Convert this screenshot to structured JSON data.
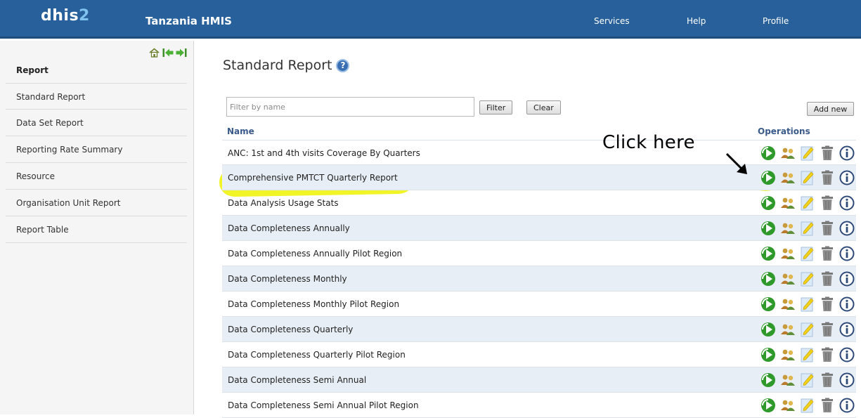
{
  "header": {
    "logo_prefix": "dhis",
    "logo_suffix": "2",
    "app_title": "Tanzania HMIS",
    "menu": [
      "Services",
      "Help",
      "Profile"
    ]
  },
  "sidebar": {
    "nav_icons": [
      "home-icon",
      "back-arrow-icon",
      "forward-arrow-icon"
    ],
    "heading": "Report",
    "items": [
      "Standard Report",
      "Data Set Report",
      "Reporting Rate Summary",
      "Resource",
      "Organisation Unit Report",
      "Report Table"
    ]
  },
  "main": {
    "title": "Standard Report",
    "filter": {
      "placeholder": "Filter by name",
      "value": ""
    },
    "buttons": {
      "filter": "Filter",
      "clear": "Clear",
      "add_new": "Add new"
    },
    "columns": {
      "name": "Name",
      "operations": "Operations"
    },
    "operation_icons": [
      "run-report-icon",
      "sharing-icon",
      "edit-icon",
      "delete-icon",
      "info-icon"
    ],
    "rows": [
      "ANC: 1st and 4th visits Coverage By Quarters",
      "Comprehensive PMTCT Quarterly Report",
      "Data Analysis Usage Stats",
      "Data Completeness Annually",
      "Data Completeness Annually Pilot Region",
      "Data Completeness Monthly",
      "Data Completeness Monthly Pilot Region",
      "Data Completeness Quarterly",
      "Data Completeness Quarterly Pilot Region",
      "Data Completeness Semi Annual",
      "Data Completeness Semi Annual Pilot Region"
    ],
    "annotation": "Click here",
    "highlight_color": "#eef200"
  },
  "colors": {
    "header_bg": "#27609b",
    "accent": "#3b6fb4",
    "row_alt": "#e8eef5"
  }
}
